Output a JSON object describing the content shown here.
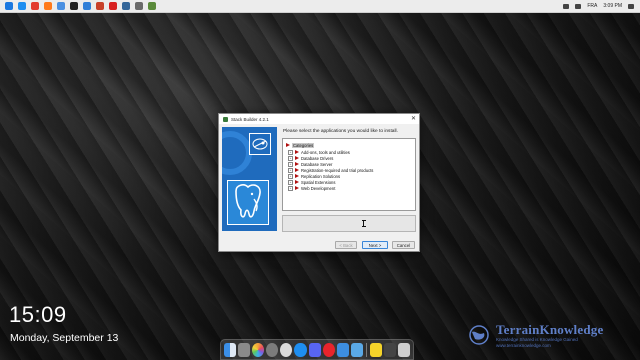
{
  "menubar": {
    "apps": [
      {
        "icon": "finder-icon",
        "color": "#1a78e0"
      },
      {
        "icon": "safari-icon",
        "color": "#1e8ef0"
      },
      {
        "icon": "chrome-icon",
        "color": "#e33b2e"
      },
      {
        "icon": "firefox-icon",
        "color": "#ff7a1a"
      },
      {
        "icon": "mail-icon",
        "color": "#4a90e2"
      },
      {
        "icon": "terminal-icon",
        "color": "#222222"
      },
      {
        "icon": "files-icon",
        "color": "#2f7fd8"
      },
      {
        "icon": "ppt-icon",
        "color": "#c8412a"
      },
      {
        "icon": "reader-icon",
        "color": "#d82020"
      },
      {
        "icon": "db-icon",
        "color": "#336699"
      },
      {
        "icon": "app-icon",
        "color": "#6a6a6a"
      },
      {
        "icon": "app2-icon",
        "color": "#5a8a3a"
      }
    ],
    "lang": "FRA",
    "time": "3:09 PM"
  },
  "clock": {
    "time": "15:09",
    "date": "Monday, September 13"
  },
  "watermark": {
    "brand": "TerrainKnowledge",
    "line1": "Knowledge Shared is Knowledge Gained",
    "line2": "www.terrainknowledge.com"
  },
  "dialog": {
    "title": "Stack Builder 4.2.1",
    "instruction": "Please select the applications you would like to install.",
    "tree": [
      {
        "label": "Categories",
        "selected": true,
        "root": true
      },
      {
        "label": "Add-ons, tools and utilities"
      },
      {
        "label": "Database Drivers"
      },
      {
        "label": "Database Server"
      },
      {
        "label": "Registration-required and trial products"
      },
      {
        "label": "Replication Solutions"
      },
      {
        "label": "Spatial Extensions"
      },
      {
        "label": "Web Development"
      }
    ],
    "buttons": {
      "back": "< Back",
      "next": "Next >",
      "cancel": "Cancel"
    },
    "close_glyph": "✕"
  },
  "dock": {
    "apps": [
      {
        "icon": "finder-icon",
        "color": "#3b8fe8"
      },
      {
        "icon": "launchpad-icon",
        "color": "#8a8a8a"
      },
      {
        "icon": "photos-icon",
        "color": "#f2a13b"
      },
      {
        "icon": "settings-icon",
        "color": "#7c7c7c"
      },
      {
        "icon": "clock-icon",
        "color": "#dcdcdc"
      },
      {
        "icon": "compass-icon",
        "color": "#1e8ef0"
      },
      {
        "icon": "discord-icon",
        "color": "#5865f2"
      },
      {
        "icon": "opera-icon",
        "color": "#e8242c"
      },
      {
        "icon": "mail-icon",
        "color": "#3d8ee0"
      },
      {
        "icon": "folder-icon",
        "color": "#5aa9e6"
      },
      {
        "icon": "notes-icon",
        "color": "#f5d42a"
      },
      {
        "icon": "window-icon",
        "color": "#444444"
      },
      {
        "icon": "trash-icon",
        "color": "#cfcfcf"
      }
    ]
  }
}
